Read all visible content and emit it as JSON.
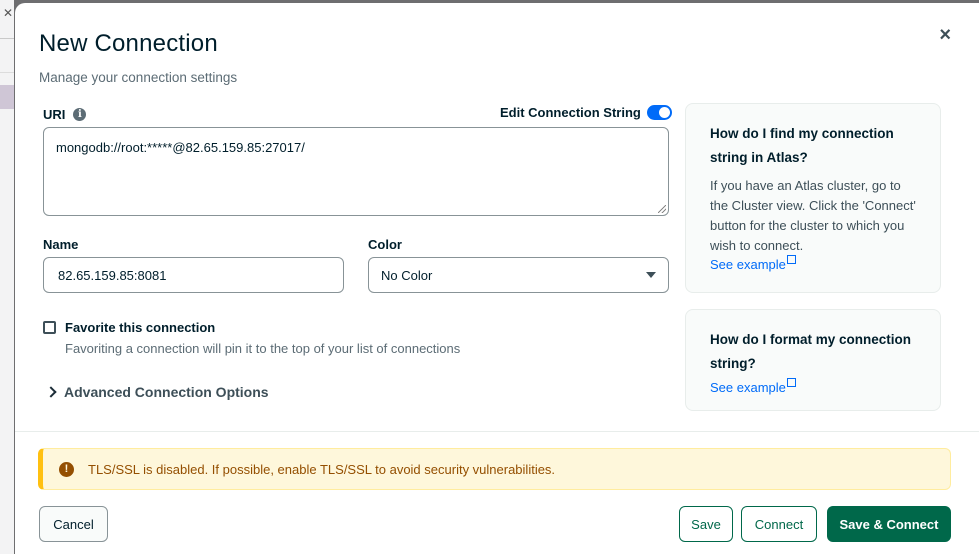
{
  "modal": {
    "title": "New Connection",
    "subtitle": "Manage your connection settings",
    "close_glyph": "×"
  },
  "uri": {
    "label": "URI",
    "edit_toggle_label": "Edit Connection String",
    "edit_toggle_on": true,
    "value": "mongodb://root:*****@82.65.159.85:27017/"
  },
  "name": {
    "label": "Name",
    "value": "82.65.159.85:8081"
  },
  "color": {
    "label": "Color",
    "selected": "No Color"
  },
  "favorite": {
    "label": "Favorite this connection",
    "description": "Favoriting a connection will pin it to the top of your list of connections",
    "checked": false
  },
  "advanced": {
    "label": "Advanced Connection Options"
  },
  "help": [
    {
      "title": "How do I find my connection string in Atlas?",
      "body": "If you have an Atlas cluster, go to the Cluster view. Click the 'Connect' button for the cluster to which you wish to connect.",
      "link": "See example"
    },
    {
      "title": "How do I format my connection string?",
      "link": "See example"
    }
  ],
  "banner": {
    "text": "TLS/SSL is disabled. If possible, enable TLS/SSL to avoid security vulnerabilities."
  },
  "footer": {
    "cancel": "Cancel",
    "save": "Save",
    "connect": "Connect",
    "save_connect": "Save & Connect"
  },
  "colors": {
    "primary_green": "#00684a",
    "toggle_blue": "#016bf8",
    "warning_bg": "#fef7db",
    "warning_text": "#944f01"
  }
}
